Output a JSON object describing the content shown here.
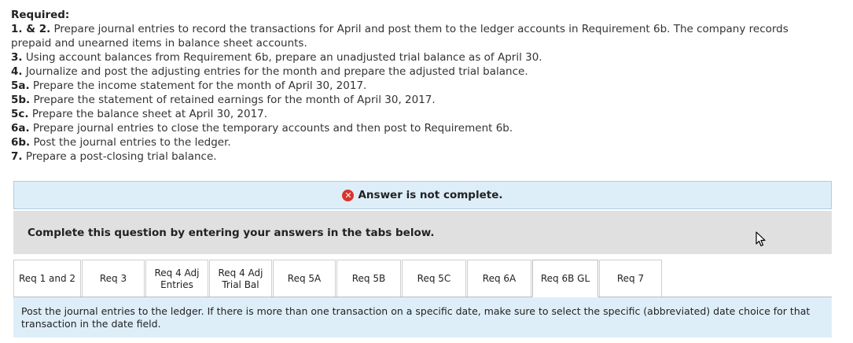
{
  "required": {
    "heading": "Required:",
    "items": [
      {
        "num": "1. & 2.",
        "text": " Prepare journal entries to record the transactions for April and post them to the ledger accounts in Requirement 6b. The company records prepaid and unearned items in balance sheet accounts."
      },
      {
        "num": "3.",
        "text": " Using account balances from Requirement 6b, prepare an unadjusted trial balance as of April 30."
      },
      {
        "num": "4.",
        "text": " Journalize and post the adjusting entries for the month and prepare the adjusted trial balance."
      },
      {
        "num": "5a.",
        "text": " Prepare the income statement for the month of April 30, 2017."
      },
      {
        "num": "5b.",
        "text": " Prepare the statement of retained earnings for the month of April 30, 2017."
      },
      {
        "num": "5c.",
        "text": " Prepare the balance sheet at April 30, 2017."
      },
      {
        "num": "6a.",
        "text": " Prepare journal entries to close the temporary accounts and then post to Requirement 6b."
      },
      {
        "num": "6b.",
        "text": " Post the journal entries to the ledger."
      },
      {
        "num": "7.",
        "text": " Prepare a post-closing trial balance."
      }
    ]
  },
  "status": {
    "icon": "✕",
    "text": "Answer is not complete."
  },
  "instructions": {
    "text": "Complete this question by entering your answers in the tabs below."
  },
  "tabs": [
    {
      "label": "Req 1 and 2"
    },
    {
      "label": "Req 3"
    },
    {
      "label": "Req 4 Adj\nEntries"
    },
    {
      "label": "Req 4 Adj\nTrial Bal"
    },
    {
      "label": "Req 5A"
    },
    {
      "label": "Req 5B"
    },
    {
      "label": "Req 5C"
    },
    {
      "label": "Req 6A"
    },
    {
      "label": "Req 6B GL"
    },
    {
      "label": "Req 7"
    }
  ],
  "active_tab": "Req 6B GL",
  "tab_content": {
    "text": "Post the journal entries to the ledger. If there is more than one transaction on a specific date, make sure to select the specific (abbreviated) date choice for that transaction in the date field."
  },
  "colors": {
    "status_bg": "#deeef9",
    "error_red": "#d9342b",
    "instr_bg": "#e0e0e0"
  }
}
